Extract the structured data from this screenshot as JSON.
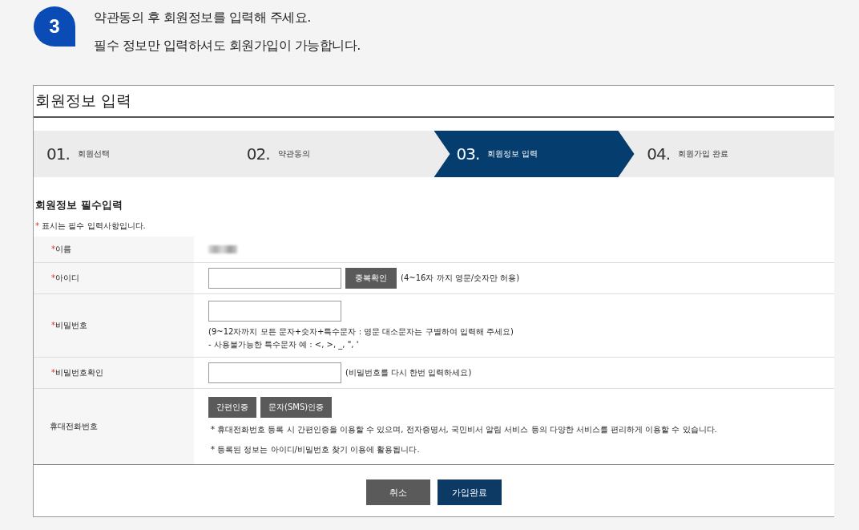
{
  "step_badge": "3",
  "intro": [
    "약관동의 후 회원정보를 입력해 주세요.",
    "필수 정보만 입력하셔도 회원가입이 가능합니다."
  ],
  "panel_title": "회원정보 입력",
  "steps": [
    {
      "number": "01.",
      "label": "회원선택",
      "selected": false
    },
    {
      "number": "02.",
      "label": "약관동의",
      "selected": false
    },
    {
      "number": "03.",
      "label": "회원정보 입력",
      "selected": true
    },
    {
      "number": "04.",
      "label": "회원가입 완료",
      "selected": false
    }
  ],
  "section_title": "회원정보 필수입력",
  "required_mark": "*",
  "required_note": "표시는 필수 입력사항입니다.",
  "rows": [
    {
      "kind": "blurred",
      "label": "이름",
      "required": true
    },
    {
      "kind": "input-button",
      "label": "아이디",
      "required": true,
      "button": "중복확인",
      "hint": "(4~16자 까지 영문/숫자만 허용)"
    },
    {
      "kind": "input-below",
      "label": "비밀번호",
      "required": true,
      "hints": [
        "(9~12자까지 모든 문자+숫자+특수문자 : 영문 대소문자는 구별하여 입력해 주세요)",
        "- 사용불가능한 특수문자 예 : <, >, _, \", '"
      ]
    },
    {
      "kind": "input-inline",
      "label": "비밀번호확인",
      "required": true,
      "hint": "(비밀번호를 다시 한번 입력하세요)"
    },
    {
      "kind": "buttons",
      "label": "휴대전화번호",
      "required": false,
      "buttons": [
        "간편인증",
        "문자(SMS)인증"
      ],
      "hints": [
        "* 휴대전화번호 등록 시 간편인증을 이용할 수 있으며, 전자증명서, 국민비서 알림 서비스 등의 다양한 서비스를 편리하게 이용할 수 있습니다.",
        "* 등록된 정보는 아이디/비밀번호 찾기 이용에 활용됩니다."
      ]
    }
  ],
  "actions": [
    {
      "label": "취소",
      "kind": "secondary"
    },
    {
      "label": "가입완료",
      "kind": "primary"
    }
  ]
}
